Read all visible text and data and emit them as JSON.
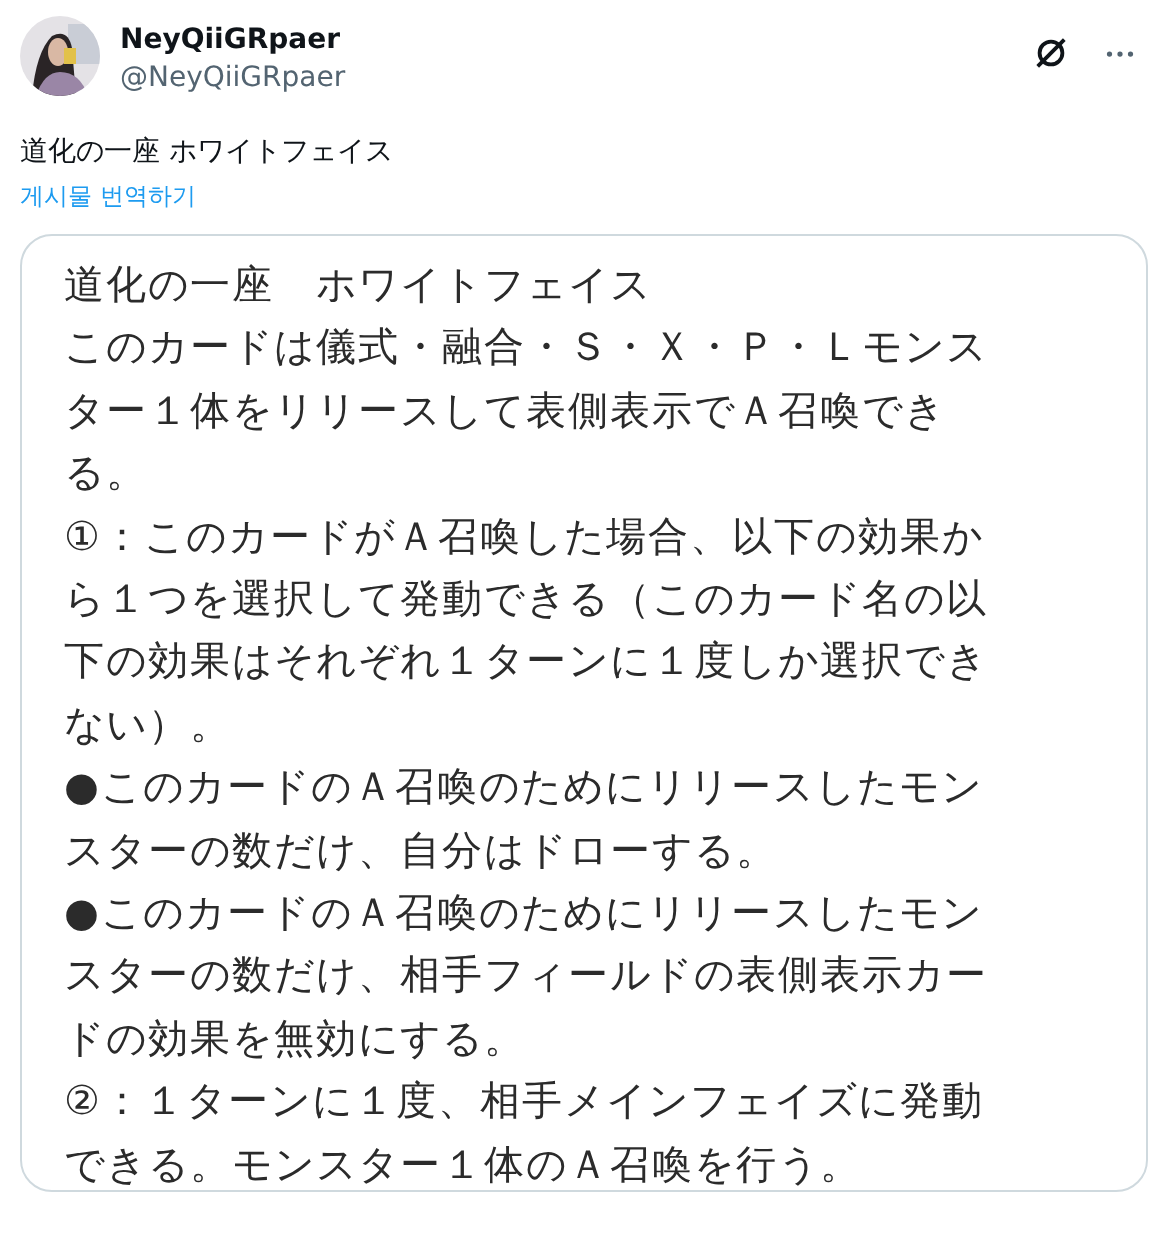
{
  "author": {
    "name": "NeyQiiGRpaer",
    "handle": "@NeyQiiGRpaer"
  },
  "post": {
    "text": "道化の一座 ホワイトフェイス",
    "translate_link": "게시물 번역하기"
  },
  "image": {
    "lines": [
      "道化の一座　ホワイトフェイス",
      "このカードは儀式・融合・Ｓ・Ｘ・Ｐ・Ｌモンス",
      "ター１体をリリースして表側表示でＡ召喚でき",
      "る。",
      "①：このカードがＡ召喚した場合、以下の効果か",
      "ら１つを選択して発動できる（このカード名の以",
      "下の効果はそれぞれ１ターンに１度しか選択でき",
      "ない）。",
      "●このカードのＡ召喚のためにリリースしたモン",
      "スターの数だけ、自分はドローする。",
      "●このカードのＡ召喚のためにリリースしたモン",
      "スターの数だけ、相手フィールドの表側表示カー",
      "ドの効果を無効にする。",
      "②：１ターンに１度、相手メインフェイズに発動",
      "できる。モンスター１体のＡ召喚を行う。"
    ]
  }
}
